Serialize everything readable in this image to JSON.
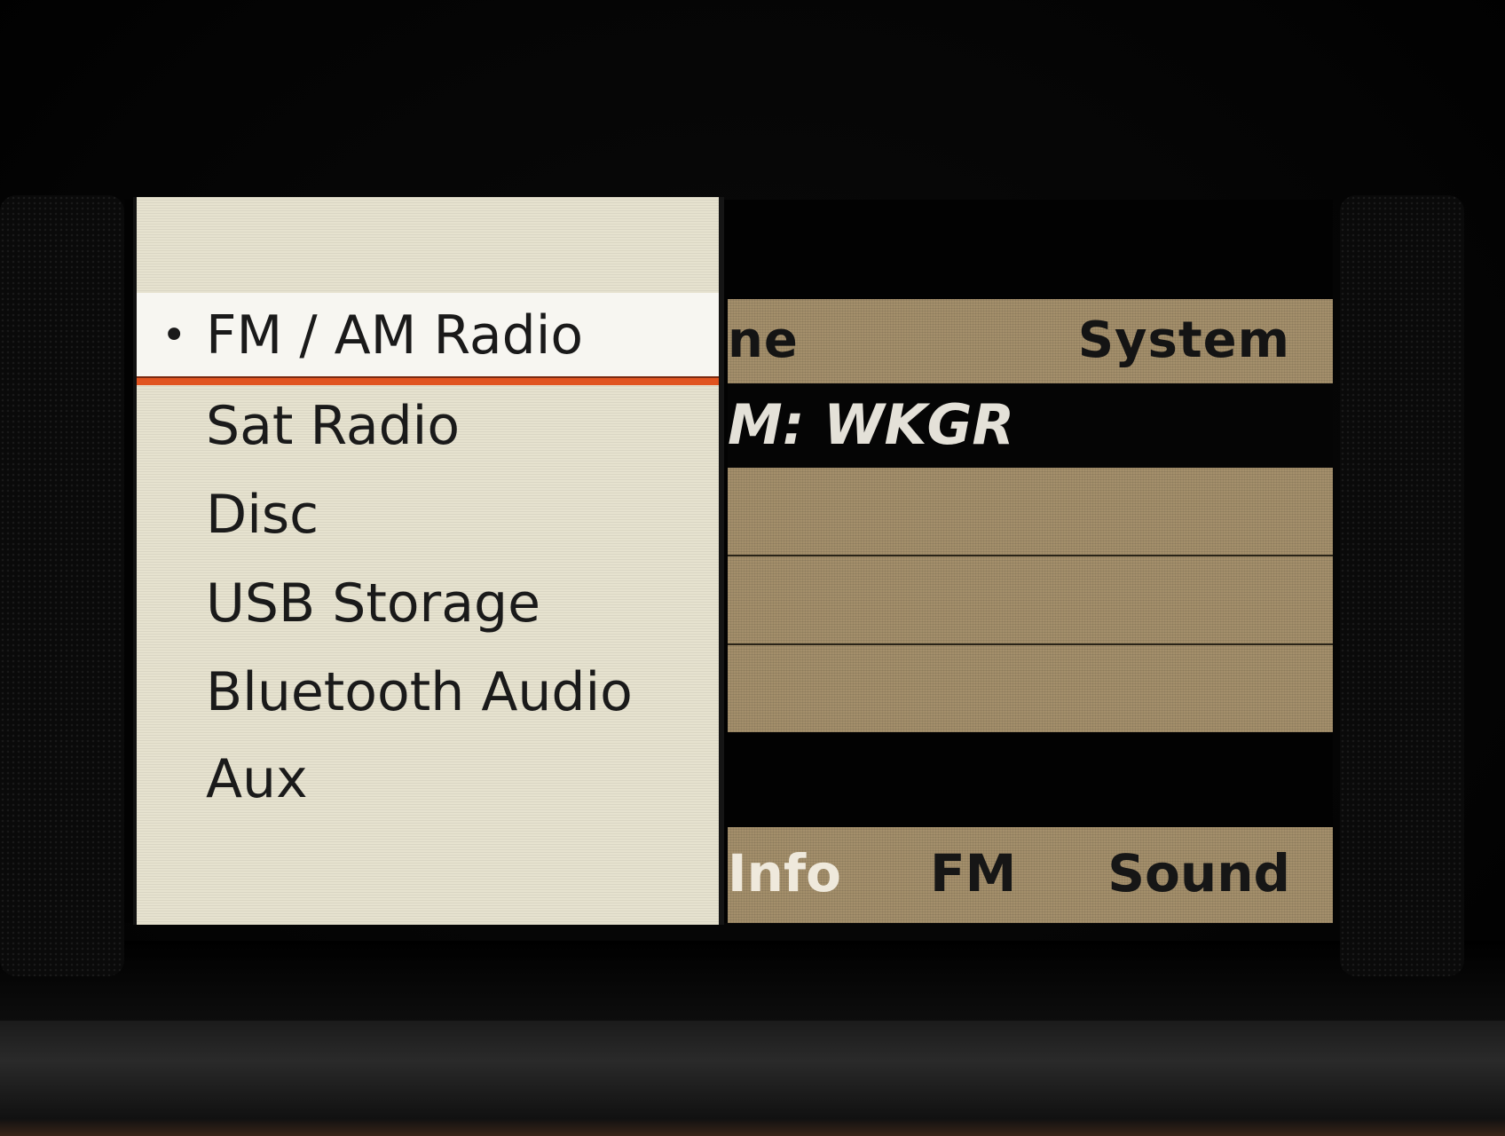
{
  "screen": {
    "top_bar": {
      "left_label": "ne",
      "right_label": "System"
    },
    "station": {
      "text": "M: WKGR"
    },
    "bottom_bar": {
      "info_label": "Info",
      "fm_label": "FM",
      "sound_label": "Sound"
    }
  },
  "source_menu": {
    "selected_bullet": "•",
    "items": [
      {
        "label": "FM / AM Radio",
        "selected": true
      },
      {
        "label": "Sat Radio",
        "selected": false
      },
      {
        "label": "Disc",
        "selected": false
      },
      {
        "label": "USB Storage",
        "selected": false
      },
      {
        "label": "Bluetooth Audio",
        "selected": false
      },
      {
        "label": "Aux",
        "selected": false
      }
    ]
  },
  "colors": {
    "tan_panel": "#a48f6b",
    "menu_background": "#e6e2cf",
    "selection_accent": "#e0531f"
  }
}
